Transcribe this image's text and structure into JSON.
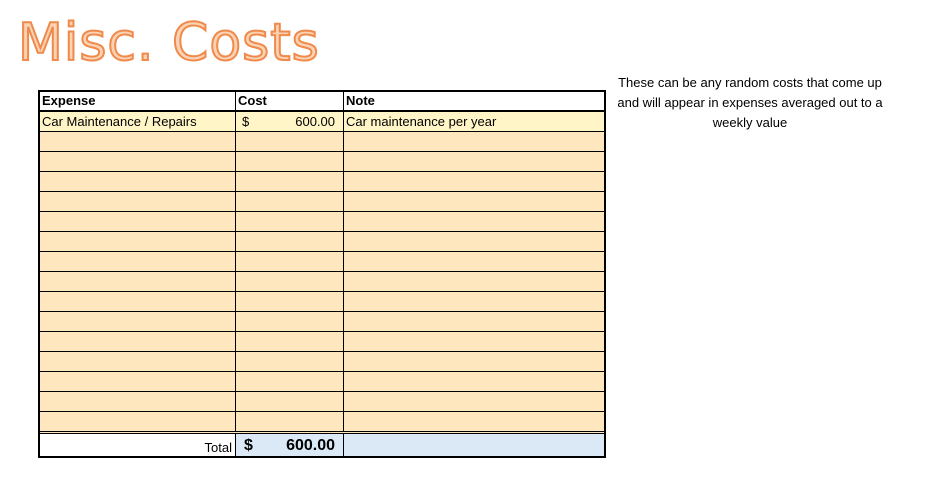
{
  "title": "Misc. Costs",
  "note": "These can be any random costs that come up and will appear in expenses averaged out to a weekly value",
  "table": {
    "headers": {
      "expense": "Expense",
      "cost": "Cost",
      "note": "Note"
    },
    "rows": [
      {
        "expense": "Car Maintenance / Repairs",
        "currency": "$",
        "cost": "600.00",
        "note": "Car maintenance per year"
      },
      {
        "expense": "",
        "currency": "",
        "cost": "",
        "note": ""
      },
      {
        "expense": "",
        "currency": "",
        "cost": "",
        "note": ""
      },
      {
        "expense": "",
        "currency": "",
        "cost": "",
        "note": ""
      },
      {
        "expense": "",
        "currency": "",
        "cost": "",
        "note": ""
      },
      {
        "expense": "",
        "currency": "",
        "cost": "",
        "note": ""
      },
      {
        "expense": "",
        "currency": "",
        "cost": "",
        "note": ""
      },
      {
        "expense": "",
        "currency": "",
        "cost": "",
        "note": ""
      },
      {
        "expense": "",
        "currency": "",
        "cost": "",
        "note": ""
      },
      {
        "expense": "",
        "currency": "",
        "cost": "",
        "note": ""
      },
      {
        "expense": "",
        "currency": "",
        "cost": "",
        "note": ""
      },
      {
        "expense": "",
        "currency": "",
        "cost": "",
        "note": ""
      },
      {
        "expense": "",
        "currency": "",
        "cost": "",
        "note": ""
      },
      {
        "expense": "",
        "currency": "",
        "cost": "",
        "note": ""
      },
      {
        "expense": "",
        "currency": "",
        "cost": "",
        "note": ""
      },
      {
        "expense": "",
        "currency": "",
        "cost": "",
        "note": ""
      }
    ],
    "total": {
      "label": "Total",
      "currency": "$",
      "value": "600.00"
    }
  },
  "colors": {
    "title_fill": "#FAD3B5",
    "title_stroke": "#F08A4B",
    "input_cells": "#FEE7BE",
    "first_row": "#FFF5C7",
    "total_cells": "#DBE9F6"
  }
}
